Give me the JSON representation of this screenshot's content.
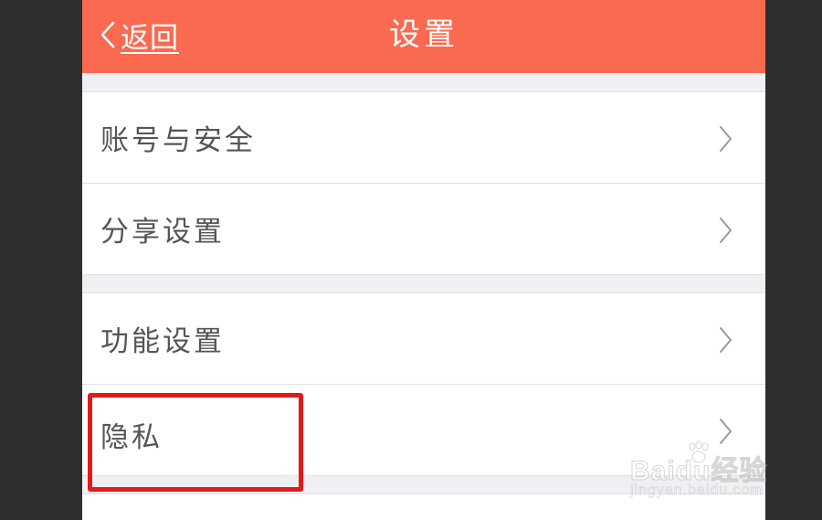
{
  "header": {
    "back_label": "返回",
    "title": "设置",
    "bar_color": "#fa6a50"
  },
  "groups": [
    {
      "items": [
        {
          "label": "账号与安全"
        },
        {
          "label": "分享设置"
        }
      ]
    },
    {
      "items": [
        {
          "label": "功能设置"
        },
        {
          "label": "隐私"
        }
      ]
    }
  ],
  "annotation": {
    "highlight_color": "#e41a1a",
    "highlighted_item": "隐私"
  },
  "watermark": {
    "logo_text": "Baidu经验",
    "url_text": "jingyan.baidu.com"
  },
  "icons": {
    "back": "chevron-left-icon",
    "row": "chevron-right-icon"
  }
}
